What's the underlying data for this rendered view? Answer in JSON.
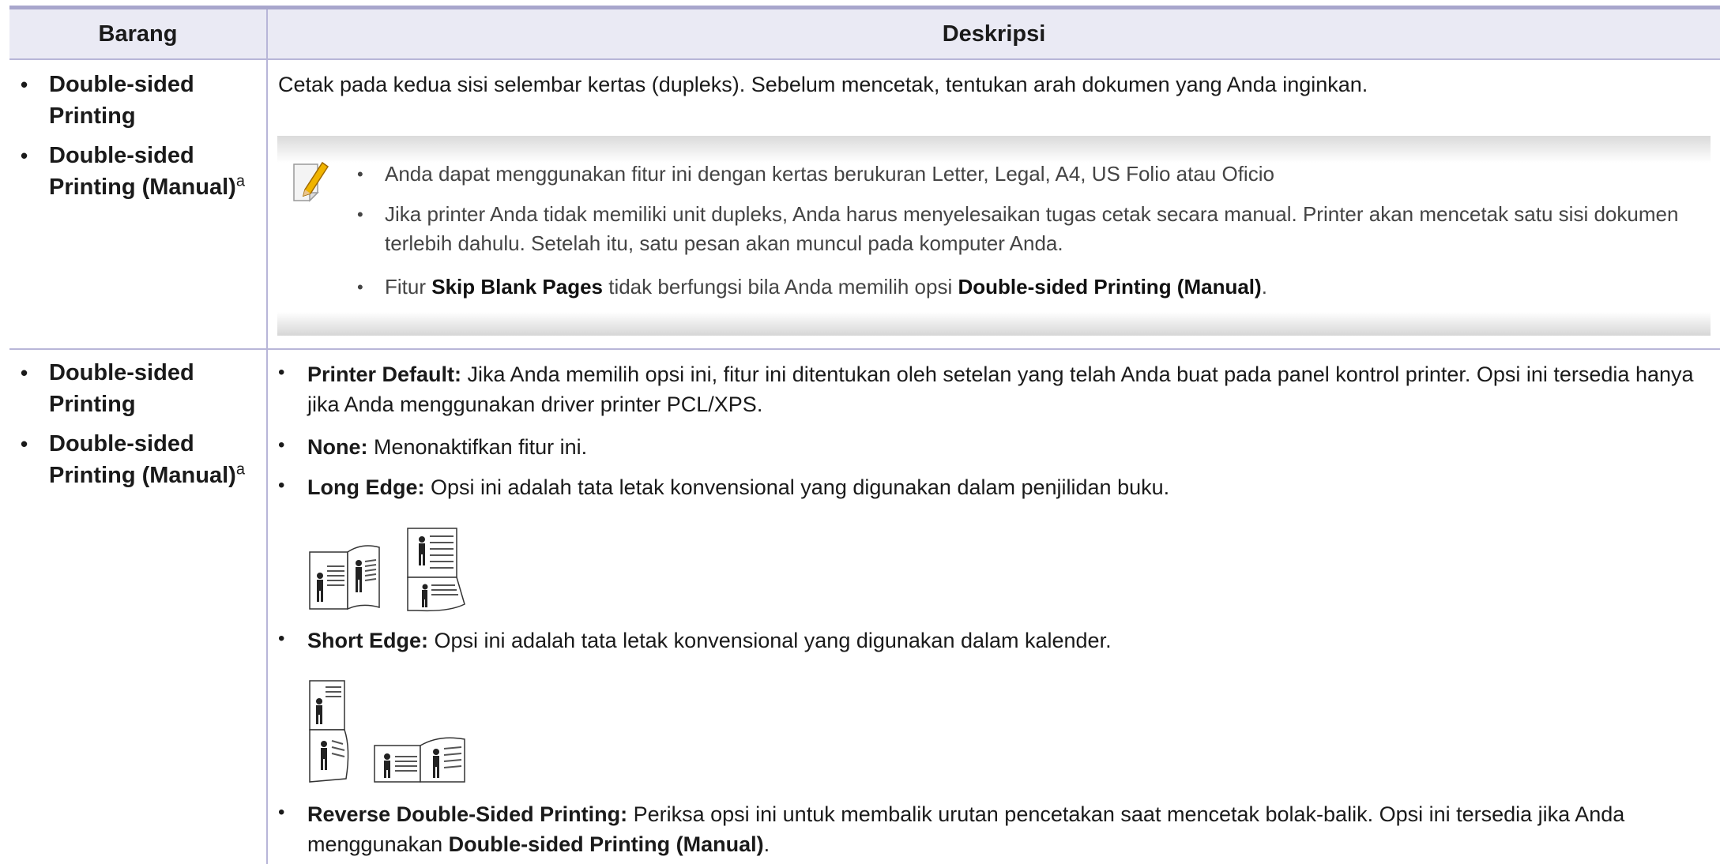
{
  "header": {
    "col1": "Barang",
    "col2": "Deskripsi"
  },
  "row1": {
    "items": [
      "Double-sided Printing",
      "Double-sided Printing (Manual)"
    ],
    "sup": "a",
    "desc": "Cetak pada kedua sisi selembar kertas (dupleks). Sebelum mencetak, tentukan arah dokumen yang Anda inginkan.",
    "note": {
      "icon": "note-pencil-icon",
      "b1": "Anda dapat menggunakan fitur ini dengan kertas berukuran Letter, Legal, A4, US Folio atau Oficio",
      "b2": "Jika printer Anda tidak memiliki unit dupleks, Anda harus menyelesaikan tugas cetak secara manual. Printer akan mencetak satu sisi dokumen terlebih dahulu. Setelah itu, satu pesan akan muncul pada komputer Anda.",
      "b3_pre": "Fitur ",
      "b3_bold1": "Skip Blank Pages",
      "b3_mid": " tidak berfungsi bila Anda memilih opsi ",
      "b3_bold2": "Double-sided Printing (Manual)",
      "b3_end": "."
    }
  },
  "row2": {
    "items": [
      "Double-sided Printing",
      "Double-sided Printing (Manual)"
    ],
    "sup": "a",
    "opt1_label": "Printer Default:",
    "opt1_text": " Jika Anda memilih opsi ini, fitur ini ditentukan oleh setelan yang telah Anda buat pada panel kontrol printer. Opsi ini tersedia hanya jika Anda menggunakan driver printer PCL/XPS.",
    "opt2_label": "None:",
    "opt2_text": " Menonaktifkan fitur ini.",
    "opt3_label": "Long Edge:",
    "opt3_text": " Opsi ini adalah tata letak konvensional yang digunakan dalam penjilidan buku.",
    "opt4_label": "Short Edge:",
    "opt4_text": " Opsi ini adalah tata letak konvensional yang digunakan dalam kalender.",
    "opt5_label": "Reverse Double-Sided Printing:",
    "opt5_text": " Periksa opsi ini untuk membalik urutan pencetakan saat mencetak bolak-balik. Opsi ini tersedia jika Anda menggunakan ",
    "opt5_bold": "Double-sided Printing (Manual)",
    "opt5_end": "."
  }
}
